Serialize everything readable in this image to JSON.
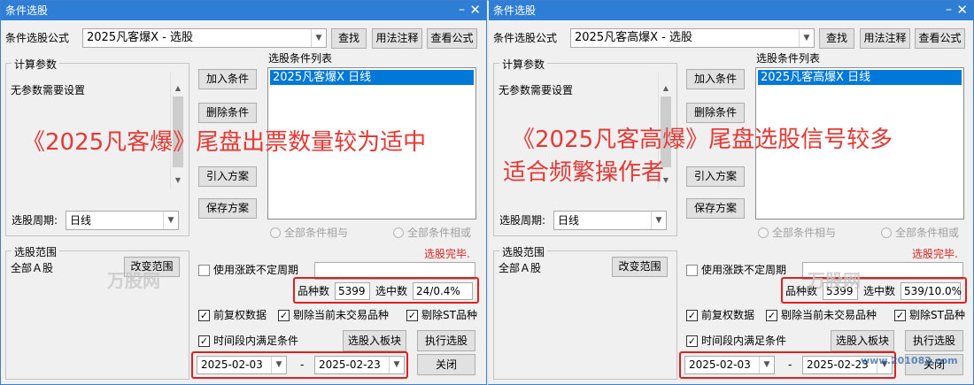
{
  "windows": [
    {
      "title": "条件选股",
      "formula_label": "条件选股公式",
      "formula_value": "2025凡客爆X  -  选股",
      "find_btn": "查找",
      "usage_btn": "用法注释",
      "view_formula_btn": "查看公式",
      "calc_group": "计算参数",
      "no_params": "无参数需要设置",
      "cond_list_title": "选股条件列表",
      "cond_list_item": "2025凡客爆X  日线",
      "add_cond": "加入条件",
      "del_cond": "删除条件",
      "import_plan": "引入方案",
      "save_plan": "保存方案",
      "period_label": "选股周期:",
      "period_value": "日线",
      "radio_and": "全部条件相与",
      "radio_or": "全部条件相或",
      "scope_group": "选股范围",
      "scope_value": "全部Ａ股",
      "change_scope": "改变范围",
      "status": "选股完毕.",
      "use_updown": "使用涨跌不定周期",
      "variety_label": "品种数",
      "variety_value": "5399",
      "selected_label": "选中数",
      "selected_value": "24/0.4%",
      "pre_adjust": "前复权数据",
      "exclude_untraded": "剔除当前未交易品种",
      "exclude_st": "剔除ST品种",
      "time_range": "时间段内满足条件",
      "to_block": "选股入板块",
      "execute": "执行选股",
      "date_from": "2025-02-03",
      "date_sep": "-",
      "date_to": "2025-02-23",
      "close": "关闭",
      "overlay_lines": [
        "《2025凡客爆》尾盘出票数量较为适中"
      ]
    },
    {
      "title": "条件选股",
      "formula_label": "条件选股公式",
      "formula_value": "2025凡客高爆X  -  选股",
      "find_btn": "查找",
      "usage_btn": "用法注释",
      "view_formula_btn": "查看公式",
      "calc_group": "计算参数",
      "no_params": "无参数需要设置",
      "cond_list_title": "选股条件列表",
      "cond_list_item": "2025凡客高爆X  日线",
      "add_cond": "加入条件",
      "del_cond": "删除条件",
      "import_plan": "引入方案",
      "save_plan": "保存方案",
      "period_label": "选股周期:",
      "period_value": "日线",
      "radio_and": "全部条件相与",
      "radio_or": "全部条件相或",
      "scope_group": "选股范围",
      "scope_value": "全部Ａ股",
      "change_scope": "改变范围",
      "status": "选股完毕.",
      "use_updown": "使用涨跌不定周期",
      "variety_label": "品种数",
      "variety_value": "5399",
      "selected_label": "选中数",
      "selected_value": "539/10.0%",
      "pre_adjust": "前复权数据",
      "exclude_untraded": "剔除当前未交易品种",
      "exclude_st": "剔除ST品种",
      "time_range": "时间段内满足条件",
      "to_block": "选股入板块",
      "execute": "执行选股",
      "date_from": "2025-02-03",
      "date_sep": "-",
      "date_to": "2025-02-23",
      "close": "关闭",
      "overlay_lines": [
        "《2025凡客高爆》尾盘选股信号较多",
        "适合频繁操作者"
      ]
    }
  ],
  "watermark": "万股网",
  "watermark_url": "www.201082.com",
  "colors": {
    "title_bar": "#2f7ed6",
    "selection": "#0078d7",
    "highlight_box": "#e02020",
    "overlay_text": "#e53935"
  }
}
